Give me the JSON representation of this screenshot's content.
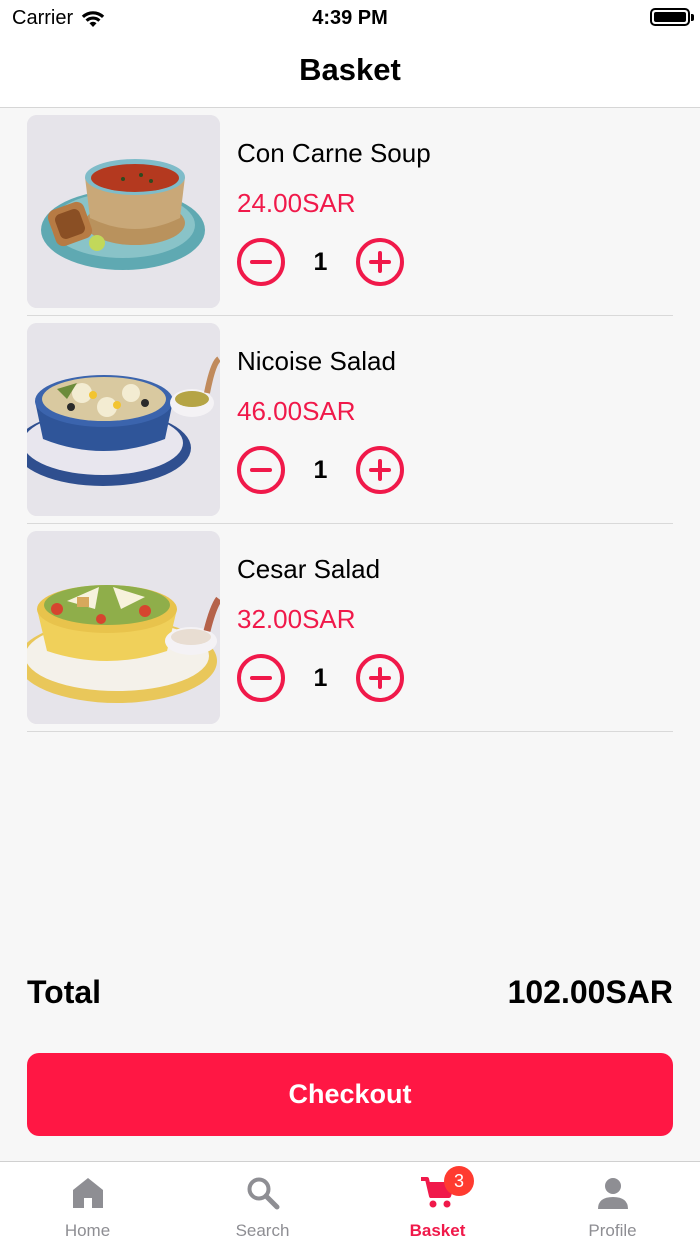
{
  "status_bar": {
    "carrier": "Carrier",
    "time": "4:39 PM"
  },
  "header": {
    "title": "Basket"
  },
  "basket": {
    "items": [
      {
        "name": "Con Carne Soup",
        "price": "24.00SAR",
        "quantity": "1"
      },
      {
        "name": "Nicoise Salad",
        "price": "46.00SAR",
        "quantity": "1"
      },
      {
        "name": "Cesar Salad",
        "price": "32.00SAR",
        "quantity": "1"
      }
    ],
    "total_label": "Total",
    "total_value": "102.00SAR",
    "checkout_label": "Checkout"
  },
  "tabbar": {
    "tabs": [
      {
        "label": "Home",
        "icon": "home-icon"
      },
      {
        "label": "Search",
        "icon": "search-icon"
      },
      {
        "label": "Basket",
        "icon": "cart-icon",
        "badge": "3"
      },
      {
        "label": "Profile",
        "icon": "person-icon"
      }
    ],
    "active": "Basket"
  },
  "colors": {
    "accent": "#f0194a",
    "checkout": "#ff1744",
    "badge": "#ff3b30",
    "inactive": "#8e8e93"
  }
}
